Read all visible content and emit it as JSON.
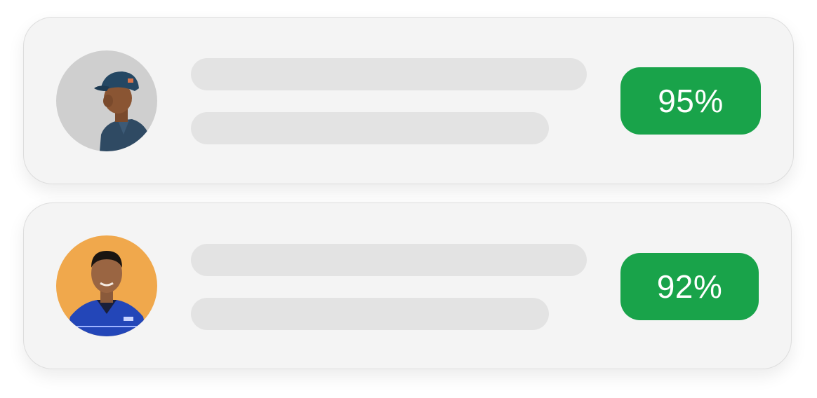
{
  "colors": {
    "badge_green": "#19a34a",
    "card_bg": "#f4f4f4",
    "skeleton": "#e3e3e3"
  },
  "candidates": [
    {
      "avatar_icon": "avatar-photo-man-blue-cap",
      "avatar_bg": "#cfcfcf",
      "score": "95%"
    },
    {
      "avatar_icon": "avatar-photo-man-blue-uniform",
      "avatar_bg": "#f0a84c",
      "score": "92%"
    }
  ]
}
